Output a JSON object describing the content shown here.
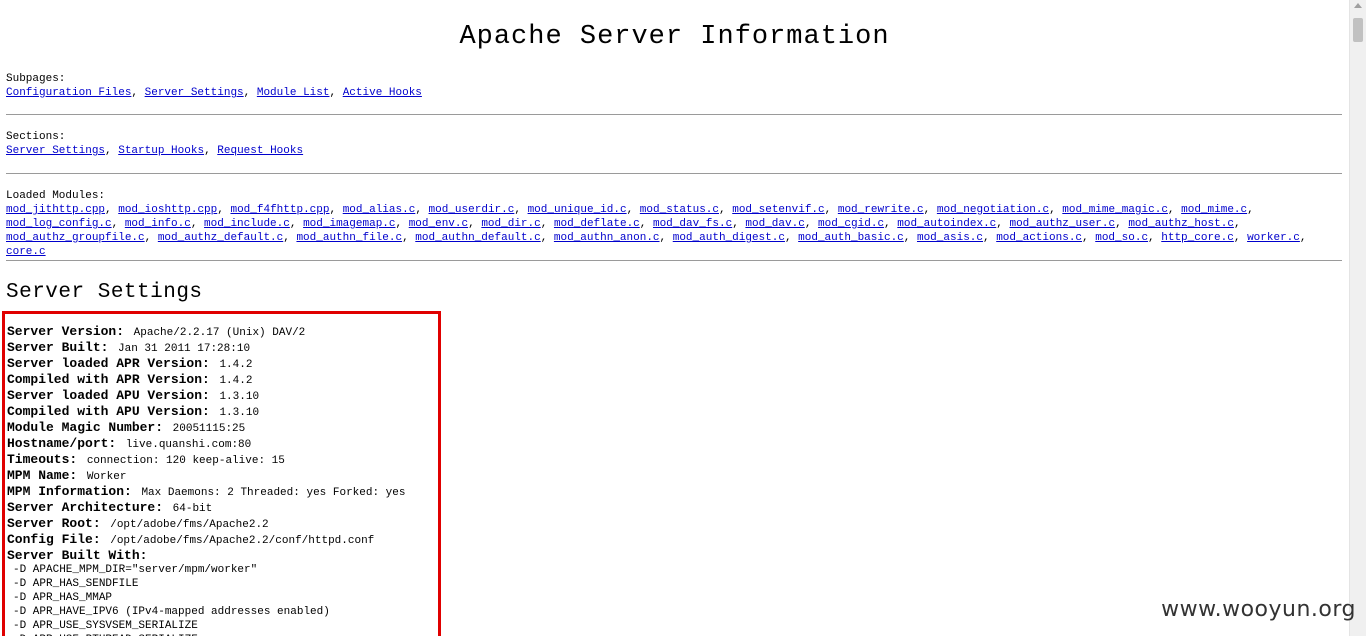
{
  "page": {
    "title": "Apache Server Information"
  },
  "subpages": {
    "label": "Subpages:",
    "links": [
      "Configuration Files",
      "Server Settings",
      "Module List",
      "Active Hooks"
    ]
  },
  "sections": {
    "label": "Sections:",
    "links": [
      "Server Settings",
      "Startup Hooks",
      "Request Hooks"
    ]
  },
  "loaded_modules": {
    "label": "Loaded Modules:",
    "links": [
      "mod_jithttp.cpp",
      "mod_ioshttp.cpp",
      "mod_f4fhttp.cpp",
      "mod_alias.c",
      "mod_userdir.c",
      "mod_unique_id.c",
      "mod_status.c",
      "mod_setenvif.c",
      "mod_rewrite.c",
      "mod_negotiation.c",
      "mod_mime_magic.c",
      "mod_mime.c",
      "mod_log_config.c",
      "mod_info.c",
      "mod_include.c",
      "mod_imagemap.c",
      "mod_env.c",
      "mod_dir.c",
      "mod_deflate.c",
      "mod_dav_fs.c",
      "mod_dav.c",
      "mod_cgid.c",
      "mod_autoindex.c",
      "mod_authz_user.c",
      "mod_authz_host.c",
      "mod_authz_groupfile.c",
      "mod_authz_default.c",
      "mod_authn_file.c",
      "mod_authn_default.c",
      "mod_authn_anon.c",
      "mod_auth_digest.c",
      "mod_auth_basic.c",
      "mod_asis.c",
      "mod_actions.c",
      "mod_so.c",
      "http_core.c",
      "worker.c",
      "core.c"
    ]
  },
  "server_settings": {
    "heading": "Server Settings",
    "rows": [
      {
        "key": "Server Version:",
        "value": "Apache/2.2.17 (Unix) DAV/2"
      },
      {
        "key": "Server Built:",
        "value": "Jan 31 2011 17:28:10"
      },
      {
        "key": "Server loaded APR Version:",
        "value": "1.4.2"
      },
      {
        "key": "Compiled with APR Version:",
        "value": "1.4.2"
      },
      {
        "key": "Server loaded APU Version:",
        "value": "1.3.10"
      },
      {
        "key": "Compiled with APU Version:",
        "value": "1.3.10"
      },
      {
        "key": "Module Magic Number:",
        "value": "20051115:25"
      },
      {
        "key": "Hostname/port:",
        "value": "live.quanshi.com:80"
      },
      {
        "key": "Timeouts:",
        "value": "connection: 120    keep-alive: 15"
      },
      {
        "key": "MPM Name:",
        "value": "Worker"
      },
      {
        "key": "MPM Information:",
        "value": "Max Daemons: 2 Threaded: yes Forked: yes"
      },
      {
        "key": "Server Architecture:",
        "value": "64-bit"
      },
      {
        "key": "Server Root:",
        "value": "/opt/adobe/fms/Apache2.2"
      },
      {
        "key": "Config File:",
        "value": "/opt/adobe/fms/Apache2.2/conf/httpd.conf"
      },
      {
        "key": "Server Built With:",
        "value": ""
      }
    ],
    "defines": [
      "-D APACHE_MPM_DIR=\"server/mpm/worker\"",
      "-D APR_HAS_SENDFILE",
      "-D APR_HAS_MMAP",
      "-D APR_HAVE_IPV6 (IPv4-mapped addresses enabled)",
      "-D APR_USE_SYSVSEM_SERIALIZE",
      "-D APR_USE_PTHREAD_SERIALIZE"
    ]
  },
  "watermark": "www.wooyun.org",
  "colors": {
    "link": "#0000cc",
    "highlight": "#e00000",
    "rule": "#9a9a9a"
  }
}
